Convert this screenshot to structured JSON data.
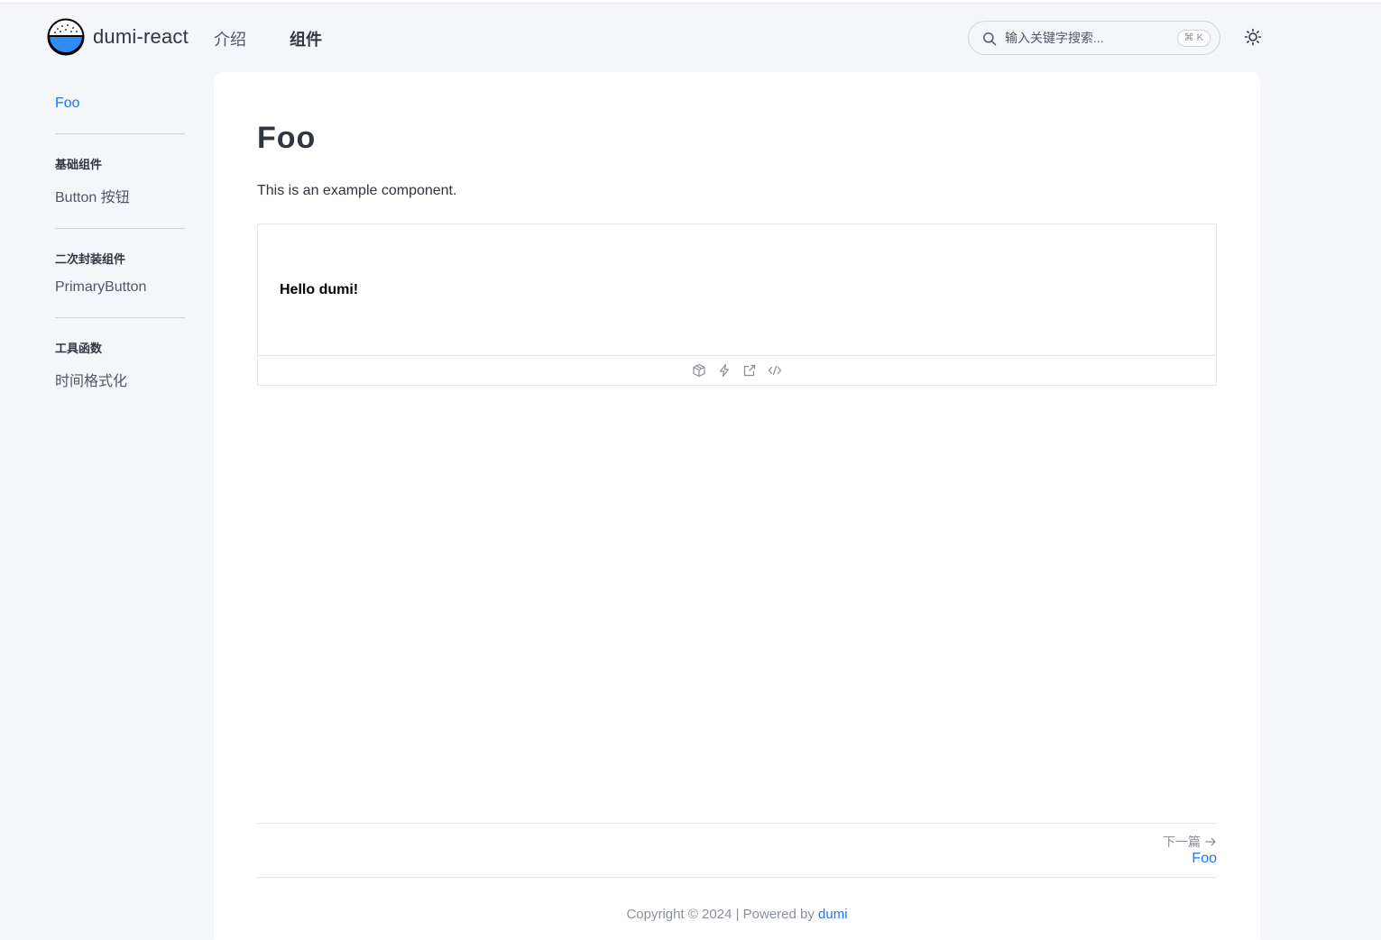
{
  "header": {
    "site_title": "dumi-react",
    "nav": [
      {
        "label": "介绍",
        "active": false
      },
      {
        "label": "组件",
        "active": true
      }
    ],
    "search": {
      "placeholder": "输入关键字搜索...",
      "shortcut": "⌘ K"
    },
    "theme_icon": "sun-icon"
  },
  "sidebar": {
    "top_link": "Foo",
    "groups": [
      {
        "title": "基础组件",
        "items": [
          "Button 按钮"
        ]
      },
      {
        "title": "二次封装组件",
        "items": [
          "PrimaryButton"
        ]
      },
      {
        "title": "工具函数",
        "items": [
          "时间格式化"
        ]
      }
    ]
  },
  "main": {
    "title": "Foo",
    "description": "This is an example component.",
    "demo": {
      "preview_text": "Hello dumi!",
      "actions": [
        "codesandbox-icon",
        "stackblitz-icon",
        "open-external-icon",
        "show-code-icon"
      ]
    },
    "next": {
      "label": "下一篇",
      "title": "Foo"
    },
    "footer": {
      "prefix": "Copyright © 2024 | Powered by ",
      "link": "dumi"
    }
  },
  "colors": {
    "accent": "#1677ff",
    "background": "#f5f6f9",
    "text": "#30363f"
  }
}
